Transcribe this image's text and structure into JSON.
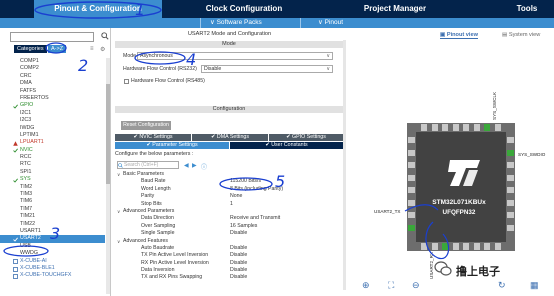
{
  "top_tabs": {
    "pinout": "Pinout & Configuration",
    "clock": "Clock Configuration",
    "project": "Project Manager",
    "tools": "Tools"
  },
  "sub_bar": {
    "software_packs": "∨ Software Packs",
    "pinout": "∨ Pinout"
  },
  "left_panel": {
    "category_tabs": [
      "Categories",
      "A->Z"
    ],
    "items": [
      {
        "label": "COMP1",
        "state": "normal"
      },
      {
        "label": "COMP2",
        "state": "normal"
      },
      {
        "label": "CRC",
        "state": "normal"
      },
      {
        "label": "DMA",
        "state": "normal"
      },
      {
        "label": "FATFS",
        "state": "normal"
      },
      {
        "label": "FREERTOS",
        "state": "normal"
      },
      {
        "label": "GPIO",
        "state": "green"
      },
      {
        "label": "I2C1",
        "state": "normal"
      },
      {
        "label": "I2C3",
        "state": "normal"
      },
      {
        "label": "IWDG",
        "state": "normal"
      },
      {
        "label": "LPTIM1",
        "state": "normal"
      },
      {
        "label": "LPUART1",
        "state": "red"
      },
      {
        "label": "NVIC",
        "state": "green"
      },
      {
        "label": "RCC",
        "state": "normal"
      },
      {
        "label": "RTC",
        "state": "normal"
      },
      {
        "label": "SPI1",
        "state": "normal"
      },
      {
        "label": "SYS",
        "state": "green"
      },
      {
        "label": "TIM2",
        "state": "normal"
      },
      {
        "label": "TIM3",
        "state": "normal"
      },
      {
        "label": "TIM6",
        "state": "normal"
      },
      {
        "label": "TIM7",
        "state": "normal"
      },
      {
        "label": "TIM21",
        "state": "normal"
      },
      {
        "label": "TIM22",
        "state": "normal"
      },
      {
        "label": "USART1",
        "state": "normal"
      },
      {
        "label": "USART2",
        "state": "selected"
      },
      {
        "label": "USB",
        "state": "normal"
      },
      {
        "label": "WWDG",
        "state": "normal"
      },
      {
        "label": "X-CUBE-AI",
        "state": "blue"
      },
      {
        "label": "X-CUBE-BLE1",
        "state": "blue"
      },
      {
        "label": "X-CUBE-TOUCHGFX",
        "state": "blue"
      }
    ]
  },
  "mid_panel": {
    "title": "USART2 Mode and Configuration",
    "mode_header": "Mode",
    "mode_label": "Mode",
    "mode_value": "Asynchronous",
    "flow_label": "Hardware Flow Control (RS232)",
    "flow_value": "Disable",
    "rs485_label": "Hardware Flow Control (RS485)",
    "config_header": "Configuration",
    "reset_button": "Reset Configuration",
    "tabs_row1": [
      "NVIC Settings",
      "DMA Settings",
      "GPIO Settings"
    ],
    "tabs_row2": [
      "Parameter Settings",
      "User Constants"
    ],
    "configure_label": "Configure the below parameters :",
    "search_placeholder": "Search (Ctrl+F)",
    "parameters": [
      {
        "type": "section",
        "name": "Basic Parameters"
      },
      {
        "type": "param",
        "name": "Baud Rate",
        "value": "115200 Bits/s"
      },
      {
        "type": "param",
        "name": "Word Length",
        "value": "8 Bits (including Parity)"
      },
      {
        "type": "param",
        "name": "Parity",
        "value": "None"
      },
      {
        "type": "param",
        "name": "Stop Bits",
        "value": "1"
      },
      {
        "type": "section",
        "name": "Advanced Parameters"
      },
      {
        "type": "param",
        "name": "Data Direction",
        "value": "Receive and Transmit"
      },
      {
        "type": "param",
        "name": "Over Sampling",
        "value": "16 Samples"
      },
      {
        "type": "param",
        "name": "Single Sample",
        "value": "Disable"
      },
      {
        "type": "section",
        "name": "Advanced Features"
      },
      {
        "type": "param",
        "name": "Auto Baudrate",
        "value": "Disable"
      },
      {
        "type": "param",
        "name": "TX Pin Active Level Inversion",
        "value": "Disable"
      },
      {
        "type": "param",
        "name": "RX Pin Active Level Inversion",
        "value": "Disable"
      },
      {
        "type": "param",
        "name": "Data Inversion",
        "value": "Disable"
      },
      {
        "type": "param",
        "name": "TX and RX Pins Swapping",
        "value": "Disable"
      }
    ]
  },
  "right_panel": {
    "view_pinout": "Pinout view",
    "view_system": "System view",
    "chip_name": "STM32L071KBUx",
    "chip_package": "UFQFPN32",
    "pin_labels": {
      "sys_swclk": "SYS_SWCLK",
      "sys_swdio": "SYS_SWDIO",
      "usart2_tx": "USART2_TX",
      "usart2_rx": "USART2_RX"
    },
    "watermark": "撸上电子"
  },
  "annotations": [
    "1",
    "2",
    "3",
    "4",
    "5"
  ],
  "colors": {
    "navy": "#03234b",
    "accent_blue": "#3c8dcf",
    "ink_blue": "#1a3fd0",
    "enabled_green": "#2c8d2c",
    "error_red": "#c0392b",
    "pin_green": "#3aa83a"
  }
}
